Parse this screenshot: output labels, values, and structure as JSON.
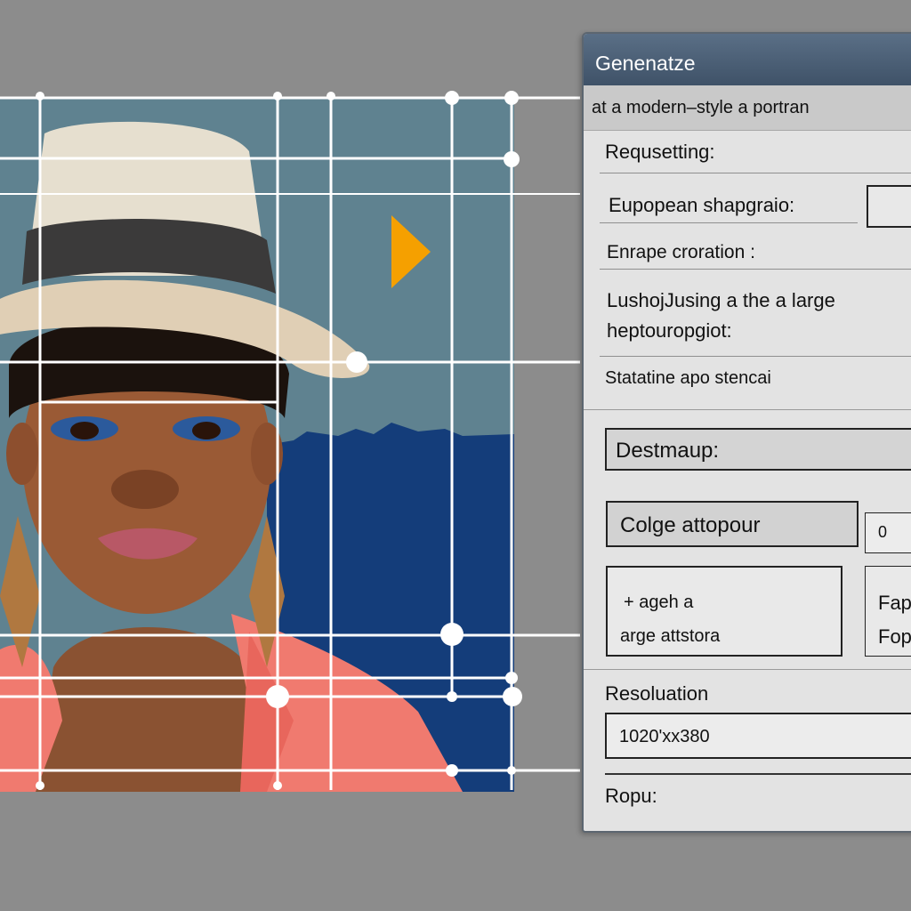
{
  "panel": {
    "title": "Genenatze",
    "prompt": "at a modern–style a portran",
    "requesting_label": "Requsetting:",
    "european_label": "Eupopean shapgraio:",
    "european_value": "",
    "enrape_label": "Enrape croration :",
    "lushoj_line1": "LushojJusing a the a large",
    "lushoj_line2": "heptouropgiot:",
    "statatine_label": "Statatine apo stencai",
    "destmaup_label": "Destmaup:",
    "colge_label": "Colge attopour",
    "colge_value": "0",
    "ageh_line1": "+  ageh a",
    "ageh_line2": "arge attstora",
    "side_line1": "Fap",
    "side_line2": "Fop",
    "resolution_label": "Resoluation",
    "resolution_value": "1020'xx380",
    "ropu_label": "Ropu:"
  },
  "colors": {
    "panel_header": "#4b5f75",
    "marker": "#f5a000",
    "guides": "#ffffff"
  },
  "icons": {
    "play_marker": "play-triangle-icon"
  }
}
